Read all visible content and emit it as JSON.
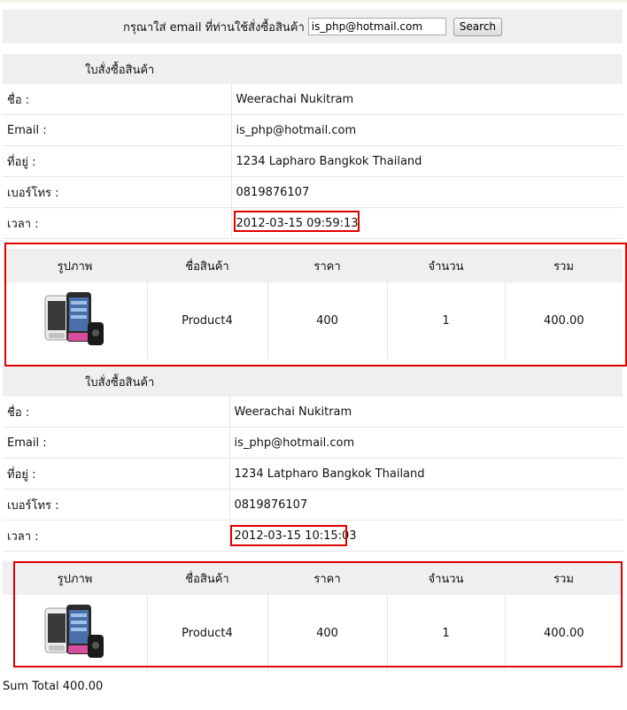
{
  "search": {
    "label": "กรุณาใส่ email ที่ท่านใช้สั่งซื้อสินค้า",
    "value": "is_php@hotmail.com",
    "button": "Search"
  },
  "orders": [
    {
      "heading": "ใบสั่งซื้อสินค้า",
      "rows": [
        {
          "key": "ชื่อ :",
          "value": "Weerachai Nukitram"
        },
        {
          "key": "Email :",
          "value": "is_php@hotmail.com"
        },
        {
          "key": "ที่อยู่ :",
          "value": "1234 Lapharo Bangkok Thailand"
        },
        {
          "key": "เบอร์โทร :",
          "value": "0819876107"
        },
        {
          "key": "เวลา :",
          "value": "2012-03-15 09:59:13"
        }
      ],
      "items_header": [
        "รูปภาพ",
        "ชื่อสินค้า",
        "ราคา",
        "จำนวน",
        "รวม"
      ],
      "items": [
        {
          "image": "phone-image",
          "name": "Product4",
          "price": "400",
          "qty": "1",
          "total": "400.00"
        }
      ]
    },
    {
      "heading": "ใบสั่งซื้อสินค้า",
      "rows": [
        {
          "key": "ชื่อ :",
          "value": "Weerachai Nukitram"
        },
        {
          "key": "Email :",
          "value": "is_php@hotmail.com"
        },
        {
          "key": "ที่อยู่ :",
          "value": "1234 Latpharo Bangkok Thailand"
        },
        {
          "key": "เบอร์โทร :",
          "value": "0819876107"
        },
        {
          "key": "เวลา :",
          "value": "2012-03-15 10:15:03"
        }
      ],
      "items_header": [
        "รูปภาพ",
        "ชื่อสินค้า",
        "ราคา",
        "จำนวน",
        "รวม"
      ],
      "items": [
        {
          "image": "phone-image",
          "name": "Product4",
          "price": "400",
          "qty": "1",
          "total": "400.00"
        }
      ]
    }
  ],
  "sum_total": "Sum Total 400.00",
  "colors": {
    "highlight": "#e00000",
    "panel": "#efefef",
    "border": "#e6e6e6"
  }
}
